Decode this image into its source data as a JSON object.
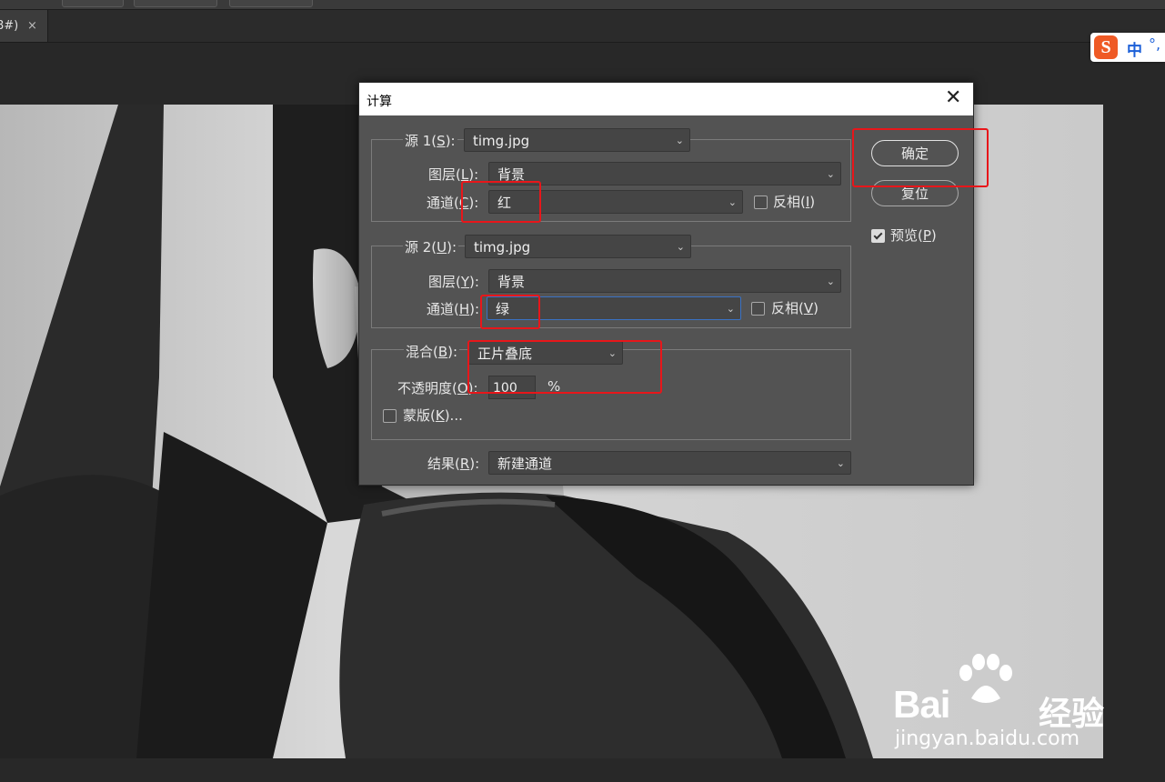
{
  "document_tab": {
    "title": "8#)",
    "close_glyph": "×"
  },
  "ime": {
    "logo": "S",
    "mode": "中",
    "punct": "°,"
  },
  "dialog": {
    "title": "计算",
    "close_glyph": "✕",
    "source1": {
      "label": "源 1(",
      "hotkey": "S",
      "label_end": "):",
      "file": "timg.jpg",
      "layer_label": "图层(",
      "layer_hotkey": "L",
      "layer_label_end": "):",
      "layer_value": "背景",
      "channel_label": "通道(",
      "channel_hotkey": "C",
      "channel_label_end": "):",
      "channel_value": "红",
      "invert_label": "反相(",
      "invert_hotkey": "I",
      "invert_label_end": ")",
      "invert_checked": false
    },
    "source2": {
      "label": "源 2(",
      "hotkey": "U",
      "label_end": "):",
      "file": "timg.jpg",
      "layer_label": "图层(",
      "layer_hotkey": "Y",
      "layer_label_end": "):",
      "layer_value": "背景",
      "channel_label": "通道(",
      "channel_hotkey": "H",
      "channel_label_end": "):",
      "channel_value": "绿",
      "invert_label": "反相(",
      "invert_hotkey": "V",
      "invert_label_end": ")",
      "invert_checked": false
    },
    "blending": {
      "label": "混合(",
      "hotkey": "B",
      "label_end": "):",
      "mode": "正片叠底",
      "opacity_label": "不透明度(",
      "opacity_hotkey": "O",
      "opacity_label_end": "):",
      "opacity_value": "100",
      "opacity_unit": "%",
      "mask_label": "蒙版(",
      "mask_hotkey": "K",
      "mask_label_end": ")...",
      "mask_checked": false
    },
    "result": {
      "label": "结果(",
      "hotkey": "R",
      "label_end": "):",
      "value": "新建通道"
    },
    "buttons": {
      "ok": "确定",
      "reset": "复位"
    },
    "preview": {
      "label": "预览(",
      "hotkey": "P",
      "label_end": ")",
      "checked": true
    },
    "chevron_glyph": "⌄"
  },
  "watermark": {
    "brand": "Bai",
    "brand_suffix": "经验",
    "url": "jingyan.baidu.com"
  },
  "colors": {
    "highlight": "#e8161a",
    "dialog_bg": "#535353",
    "focus_border": "#3a72c4"
  }
}
